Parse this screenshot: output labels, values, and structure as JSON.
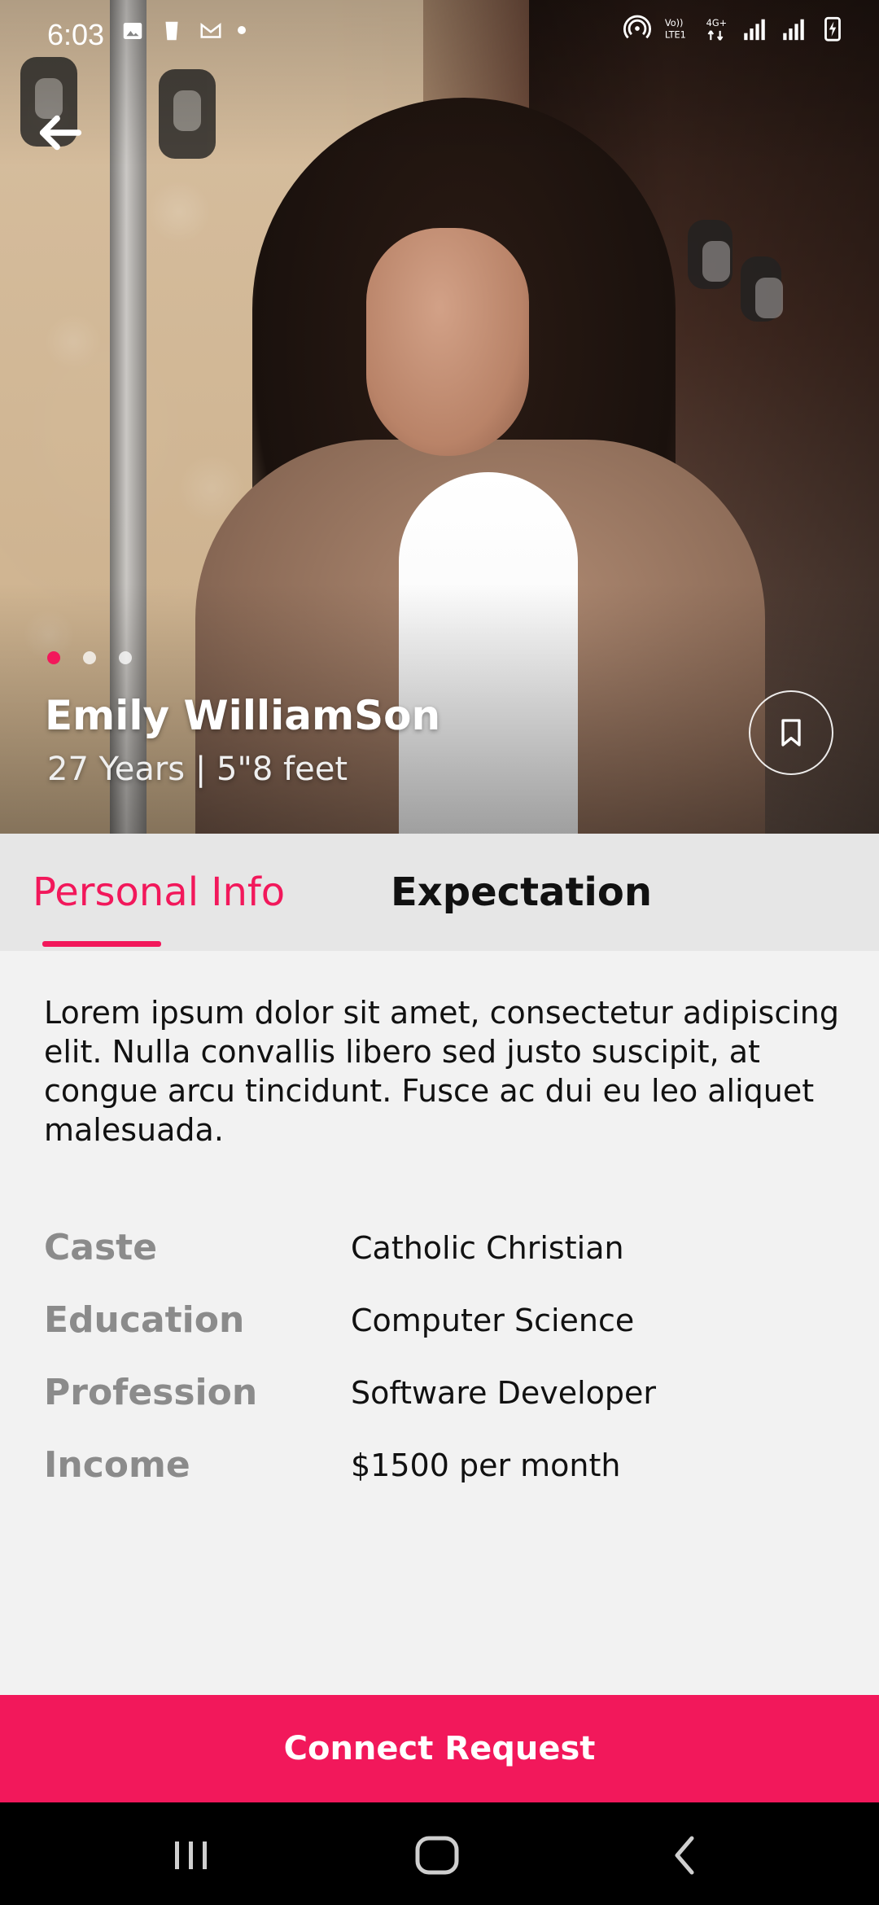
{
  "status_bar": {
    "time": "6:03",
    "left_icons": [
      "gallery-icon",
      "cup-icon",
      "gmail-icon",
      "dot-icon"
    ],
    "right_icons": [
      "hotspot-icon",
      "volte-icon",
      "4g-icon",
      "signal-icon",
      "signal-icon",
      "battery-charging-icon"
    ]
  },
  "hero": {
    "carousel_total": 3,
    "carousel_active_index": 0
  },
  "profile": {
    "name": "Emily WilliamSon",
    "meta": "27 Years | 5\"8 feet"
  },
  "tabs": {
    "personal_info": "Personal Info",
    "expectation": "Expectation",
    "active": "personal_info"
  },
  "about": {
    "text": "Lorem ipsum dolor sit amet, consectetur adipiscing elit. Nulla convallis libero sed justo suscipit, at congue arcu tincidunt. Fusce ac dui eu leo aliquet malesuada."
  },
  "details": [
    {
      "label": "Caste",
      "value": "Catholic Christian"
    },
    {
      "label": "Education",
      "value": "Computer Science"
    },
    {
      "label": "Profession",
      "value": "Software Developer"
    },
    {
      "label": "Income",
      "value": "$1500 per month"
    }
  ],
  "cta": {
    "label": "Connect Request"
  },
  "colors": {
    "accent": "#f2185b",
    "tabs_bg": "#e6e6e6",
    "page_bg": "#f2f2f2",
    "label_gray": "#8b8b8b"
  }
}
